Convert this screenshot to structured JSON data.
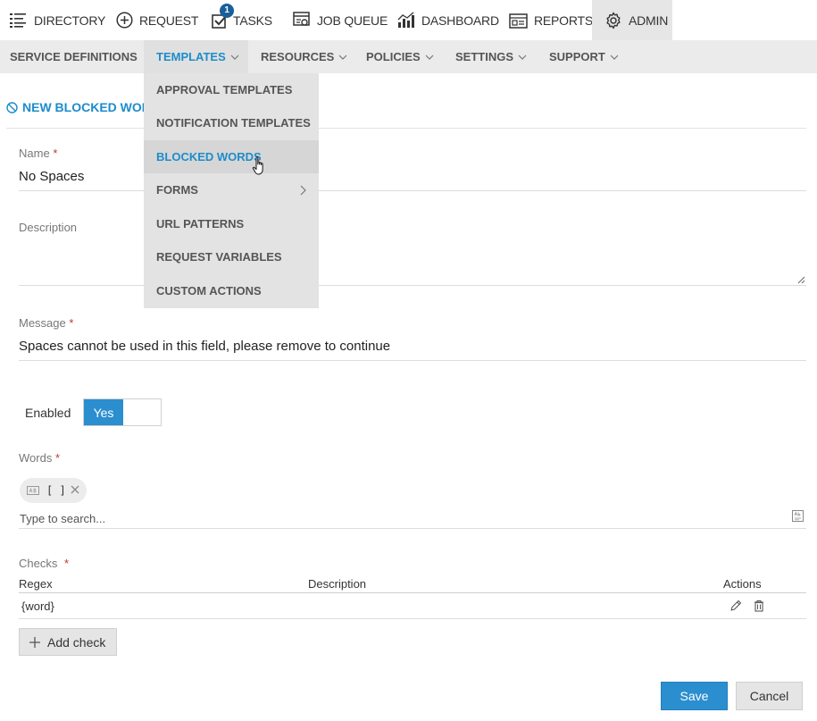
{
  "topnav": {
    "directory": "DIRECTORY",
    "request": "REQUEST",
    "tasks": "TASKS",
    "tasks_badge": "1",
    "job_queue": "JOB QUEUE",
    "dashboard": "DASHBOARD",
    "reports": "REPORTS",
    "admin": "ADMIN"
  },
  "subnav": {
    "service_definitions": "SERVICE DEFINITIONS",
    "templates": "TEMPLATES",
    "resources": "RESOURCES",
    "policies": "POLICIES",
    "settings": "SETTINGS",
    "support": "SUPPORT"
  },
  "dropdown": {
    "items": [
      "APPROVAL TEMPLATES",
      "NOTIFICATION TEMPLATES",
      "BLOCKED WORDS",
      "FORMS",
      "URL PATTERNS",
      "REQUEST VARIABLES",
      "CUSTOM ACTIONS"
    ]
  },
  "page": {
    "title": "NEW BLOCKED WOR"
  },
  "form": {
    "name_label": "Name",
    "name_value": "No Spaces",
    "description_label": "Description",
    "message_label": "Message",
    "message_value": "Spaces cannot be used in this field, please remove to continue",
    "enabled_label": "Enabled",
    "enabled_value": "Yes",
    "words_label": "Words",
    "word_chip": "[ ]",
    "search_placeholder": "Type to search...",
    "checks_label": "Checks",
    "required_mark": "*"
  },
  "checks_table": {
    "headers": [
      "Regex",
      "Description",
      "Actions"
    ],
    "rows": [
      {
        "regex": "{word}",
        "description": ""
      }
    ]
  },
  "buttons": {
    "add_check": "Add check",
    "save": "Save",
    "cancel": "Cancel"
  },
  "colors": {
    "accent": "#1d8ccb",
    "primary_button": "#2b8ecf",
    "required": "#c0392b"
  }
}
